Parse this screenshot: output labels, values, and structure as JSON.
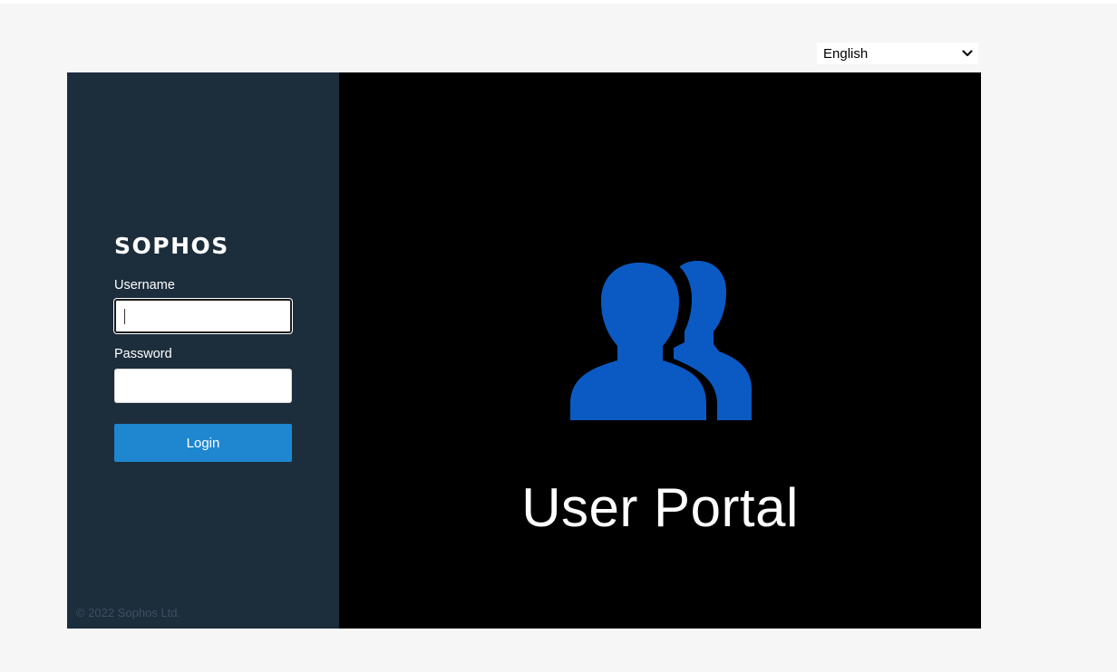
{
  "language_selector": {
    "selected": "English",
    "icon": "chevron-down-icon"
  },
  "brand": {
    "logo_text": "SOPHOS",
    "copyright": "© 2022 Sophos Ltd."
  },
  "login_form": {
    "username_label": "Username",
    "username_value": "",
    "password_label": "Password",
    "password_value": "",
    "login_button": "Login"
  },
  "hero": {
    "icon": "users-icon",
    "title": "User Portal"
  },
  "colors": {
    "page_bg": "#f6f6f6",
    "left_panel_bg": "#1c2d3c",
    "right_panel_bg": "#000000",
    "button_bg": "#1f86d0",
    "icon_color": "#0b5ac4"
  }
}
